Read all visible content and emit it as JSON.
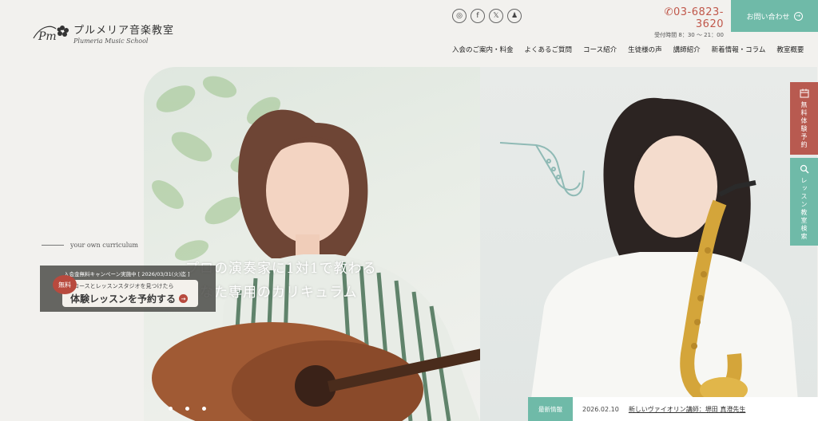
{
  "logo": {
    "name_jp": "プルメリア音楽教室",
    "name_en": "Plumeria Music School"
  },
  "social": [
    {
      "icon": "instagram-icon",
      "glyph": "◎"
    },
    {
      "icon": "facebook-icon",
      "glyph": "f"
    },
    {
      "icon": "x-icon",
      "glyph": "𝕏"
    },
    {
      "icon": "lesson-app-icon",
      "glyph": "♟"
    }
  ],
  "contact": {
    "phone": "03-6823-3620",
    "hours": "受付時間 8：30 ～ 21：00",
    "button_label": "お問い合わせ"
  },
  "nav": [
    "入会のご案内・料金",
    "よくあるご質問",
    "コース紹介",
    "生徒様の声",
    "講師紹介",
    "新着情報・コラム",
    "教室概要"
  ],
  "hero": {
    "headline_line1": "プロの演奏家に1対1で教わる",
    "headline_line2": "あなた専用のカリキュラム",
    "subline": "your own curriculum",
    "campaign_head": "入会金無料キャンペーン実施中 [ 2026/03/31(火)迄 ]",
    "campaign_small": "コースとレッスンスタジオを見つけたら",
    "campaign_cta": "体験レッスンを予約する",
    "free_badge": "無料"
  },
  "news": {
    "label": "最新情報",
    "date": "2026.02.10",
    "title": "新しいヴァイオリン講師：堺田 真澄先生"
  },
  "side_tabs": {
    "trial": "無料体験予約",
    "search": "レッスン教室検索"
  },
  "colors": {
    "accent": "#6fbaa8",
    "brand_red": "#b84a3e",
    "phone_red": "#c0574a"
  }
}
